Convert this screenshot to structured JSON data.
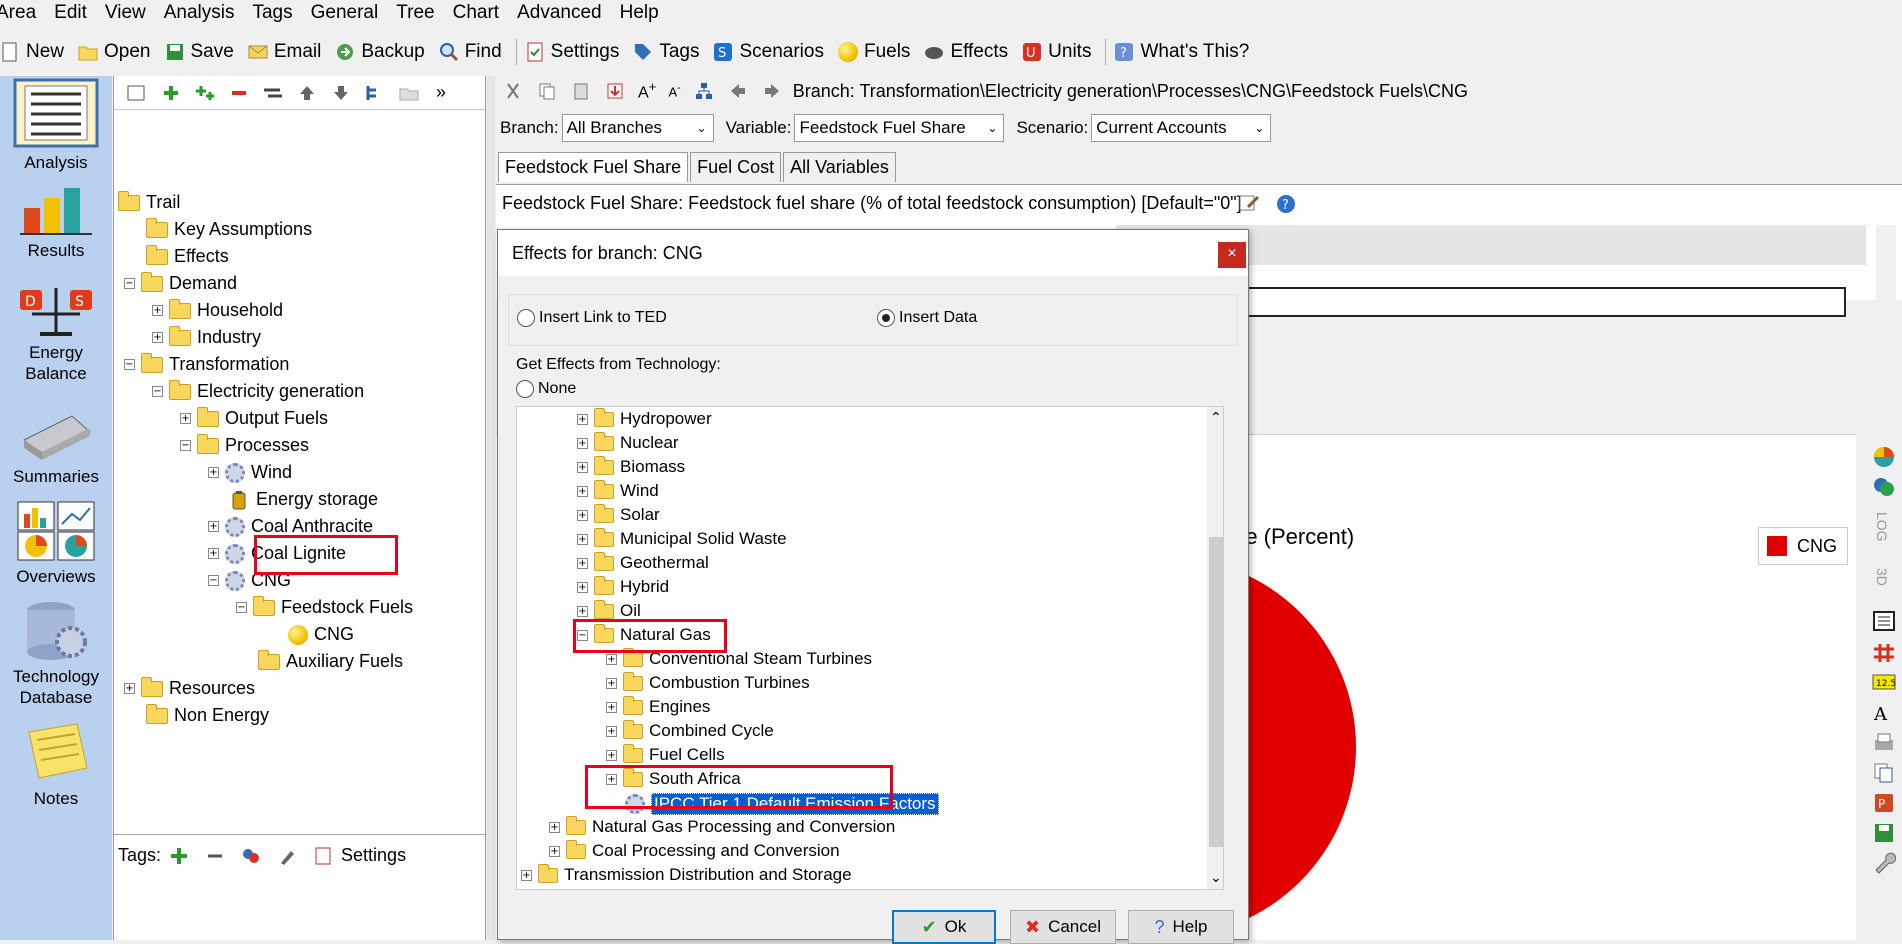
{
  "menu": [
    "Area",
    "Edit",
    "View",
    "Analysis",
    "Tags",
    "General",
    "Tree",
    "Chart",
    "Advanced",
    "Help"
  ],
  "toolbar": {
    "new": "New",
    "open": "Open",
    "save": "Save",
    "email": "Email",
    "backup": "Backup",
    "find": "Find",
    "settings": "Settings",
    "tags": "Tags",
    "scenarios": "Scenarios",
    "fuels": "Fuels",
    "effects": "Effects",
    "units": "Units",
    "whats_this": "What's This?"
  },
  "nav": [
    {
      "label": "Analysis",
      "label2": ""
    },
    {
      "label": "Results",
      "label2": ""
    },
    {
      "label": "Energy",
      "label2": "Balance"
    },
    {
      "label": "Summaries",
      "label2": ""
    },
    {
      "label": "Overviews",
      "label2": ""
    },
    {
      "label": "Technology",
      "label2": "Database"
    },
    {
      "label": "Notes",
      "label2": ""
    }
  ],
  "tree": {
    "items": [
      "Trail",
      "Key Assumptions",
      "Effects",
      "Demand",
      "Household",
      "Industry",
      "Transformation",
      "Electricity generation",
      "Output Fuels",
      "Processes",
      "Wind",
      "Energy storage",
      "Coal Anthracite",
      "Coal Lignite",
      "CNG",
      "Feedstock Fuels",
      "CNG",
      "Auxiliary Fuels",
      "Resources",
      "Non Energy"
    ]
  },
  "tags": {
    "label": "Tags:",
    "settings": "Settings"
  },
  "branch_path": "Branch: Transformation\\Electricity generation\\Processes\\CNG\\Feedstock Fuels\\CNG",
  "selectors": {
    "branch_label": "Branch:",
    "branch_value": "All Branches",
    "variable_label": "Variable:",
    "variable_value": "Feedstock Fuel Share",
    "scenario_label": "Scenario:",
    "scenario_value": "Current Accounts"
  },
  "tabs": [
    "Feedstock Fuel Share",
    "Fuel Cost",
    "All Variables"
  ],
  "variable_info": "Feedstock Fuel Share: Feedstock fuel share (% of total feedstock consumption) [Default=\"0\"]",
  "chart": {
    "title_fragment": "re (Percent)",
    "legend": "CNG",
    "color": "#e00000"
  },
  "dialog": {
    "title": "Effects for branch: CNG",
    "close": "×",
    "radio_ted": "Insert Link to TED",
    "radio_data": "Insert Data",
    "get_effects": "Get Effects from Technology:",
    "none": "None",
    "list": [
      "Hydropower",
      "Nuclear",
      "Biomass",
      "Wind",
      "Solar",
      "Municipal Solid Waste",
      "Geothermal",
      "Hybrid",
      "Oil",
      "Natural Gas",
      "Conventional Steam Turbines",
      "Combustion Turbines",
      "Engines",
      "Combined Cycle",
      "Fuel Cells",
      "South Africa",
      "IPCC Tier 1 Default Emission Factors",
      "Natural Gas Processing and Conversion",
      "Coal Processing and Conversion",
      "Transmission Distribution and Storage"
    ],
    "ok": "Ok",
    "cancel": "Cancel",
    "help": "Help"
  }
}
